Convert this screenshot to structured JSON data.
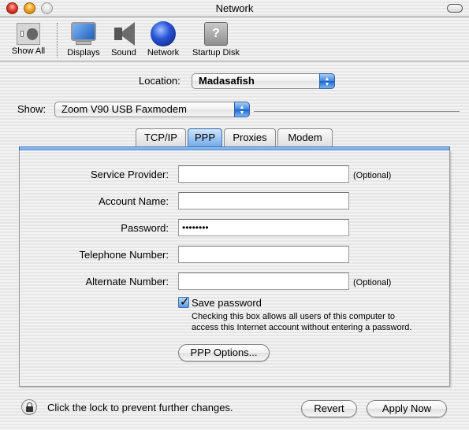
{
  "window": {
    "title": "Network"
  },
  "toolbar": {
    "items": [
      {
        "label": "Show All",
        "icon": "show-all-icon"
      },
      {
        "label": "Displays",
        "icon": "displays-icon"
      },
      {
        "label": "Sound",
        "icon": "sound-icon"
      },
      {
        "label": "Network",
        "icon": "network-globe-icon"
      },
      {
        "label": "Startup Disk",
        "icon": "startup-disk-icon"
      }
    ]
  },
  "location": {
    "label": "Location:",
    "value": "Madasafish"
  },
  "show": {
    "label": "Show:",
    "value": "Zoom V90 USB Faxmodem"
  },
  "tabs": [
    {
      "label": "TCP/IP",
      "active": false
    },
    {
      "label": "PPP",
      "active": true
    },
    {
      "label": "Proxies",
      "active": false
    },
    {
      "label": "Modem",
      "active": false
    }
  ],
  "form": {
    "optional_label": "(Optional)",
    "fields": [
      {
        "label": "Service Provider:",
        "value": "",
        "optional": true
      },
      {
        "label": "Account Name:",
        "value": "",
        "optional": false
      },
      {
        "label": "Password:",
        "value": "••••••••",
        "optional": false
      },
      {
        "label": "Telephone Number:",
        "value": "",
        "optional": false
      },
      {
        "label": "Alternate Number:",
        "value": "",
        "optional": true
      }
    ],
    "save_password": {
      "label": "Save password",
      "checked": true,
      "help_line1": "Checking this box allows all users of this computer to",
      "help_line2": "access this Internet account without entering a password."
    },
    "ppp_options_label": "PPP Options..."
  },
  "footer": {
    "lock_text": "Click the lock to prevent further changes.",
    "revert_label": "Revert",
    "apply_label": "Apply Now"
  },
  "colors": {
    "accent_blue": "#5a98e2",
    "close": "#e0402f",
    "minimize": "#f0a628"
  }
}
